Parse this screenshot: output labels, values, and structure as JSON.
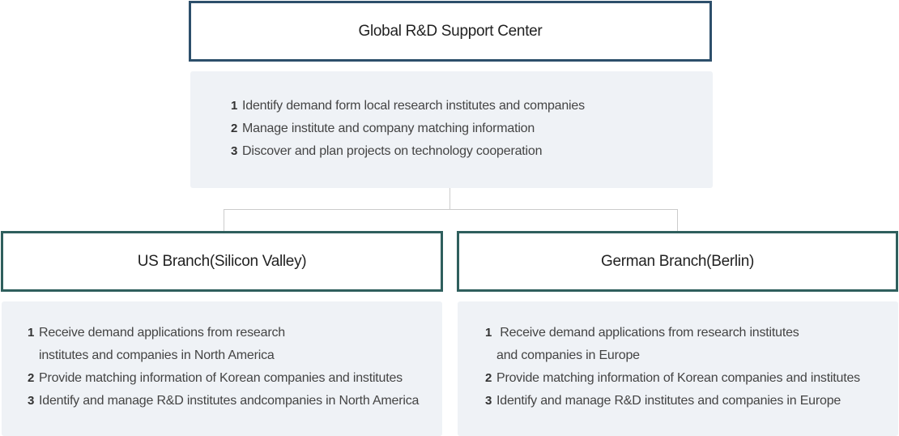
{
  "center": {
    "title": "Global R&D Support Center",
    "items": [
      {
        "num": "1",
        "text": "Identify demand form local research institutes and companies"
      },
      {
        "num": "2",
        "text": "Manage institute and company matching information"
      },
      {
        "num": "3",
        "text": "Discover and plan projects on technology cooperation"
      }
    ]
  },
  "us_branch": {
    "title": "US Branch(Silicon Valley)",
    "items": [
      {
        "num": "1",
        "text": "Receive demand applications from research institutes and companies in North America"
      },
      {
        "num": "2",
        "text": "Provide matching information of Korean companies and institutes"
      },
      {
        "num": "3",
        "text": "Identify and manage R&D institutes andcompanies in North America"
      }
    ]
  },
  "german_branch": {
    "title": "German Branch(Berlin)",
    "items": [
      {
        "num": "1",
        "text": " Receive demand applications from research institutes and companies in Europe"
      },
      {
        "num": "2",
        "text": "Provide matching information of Korean companies and institutes"
      },
      {
        "num": "3",
        "text": "Identify and manage R&D institutes and companies in Europe"
      }
    ]
  },
  "colors": {
    "center_border": "#2d4f6b",
    "branch_border": "#2f5f5d",
    "panel_bg": "#eff2f6",
    "connector": "#cccccc"
  }
}
